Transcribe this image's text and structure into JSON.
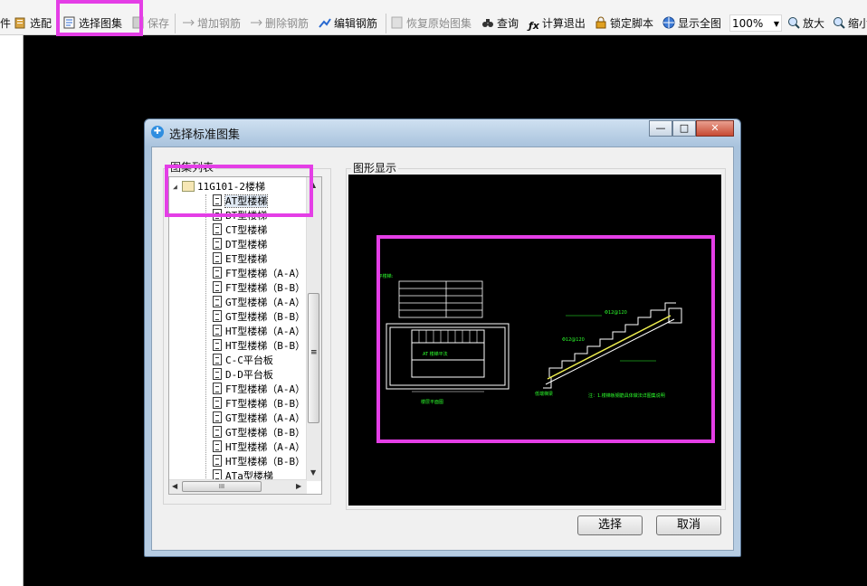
{
  "toolbar": {
    "items": [
      {
        "label": "件",
        "state": "enabled"
      },
      {
        "label": "选配",
        "state": "enabled"
      },
      {
        "label": "选择图集",
        "state": "enabled"
      },
      {
        "label": "保存",
        "state": "disabled"
      },
      {
        "label": "增加钢筋",
        "state": "disabled"
      },
      {
        "label": "删除钢筋",
        "state": "disabled"
      },
      {
        "label": "编辑钢筋",
        "state": "enabled"
      },
      {
        "label": "恢复原始图集",
        "state": "disabled"
      },
      {
        "label": "查询",
        "state": "enabled"
      },
      {
        "label": "计算退出",
        "state": "enabled"
      },
      {
        "label": "锁定脚本",
        "state": "enabled"
      },
      {
        "label": "显示全图",
        "state": "enabled"
      },
      {
        "label": "放大",
        "state": "enabled"
      },
      {
        "label": "缩小",
        "state": "enabled"
      }
    ],
    "zoom_value": "100%"
  },
  "dialog": {
    "title": "选择标准图集",
    "list_group_label": "图集列表",
    "preview_group_label": "图形显示",
    "tree_root": "11G101-2楼梯",
    "tree_items": [
      "AT型楼梯",
      "BT型楼梯",
      "CT型楼梯",
      "DT型楼梯",
      "ET型楼梯",
      "FT型楼梯（A-A）",
      "FT型楼梯（B-B）",
      "GT型楼梯（A-A）",
      "GT型楼梯（B-B）",
      "HT型楼梯（A-A）",
      "HT型楼梯（B-B）",
      "C-C平台板",
      "D-D平台板",
      "FT型楼梯（A-A）",
      "FT型楼梯（B-B）",
      "GT型楼梯（A-A）",
      "GT型楼梯（B-B）",
      "HT型楼梯（A-A）",
      "HT型楼梯（B-B）",
      "ATa型楼梯"
    ],
    "selected_item": "AT型楼梯",
    "select_button": "选择",
    "cancel_button": "取消",
    "window_buttons": {
      "minimize": "—",
      "maximize": "□",
      "close": "✕"
    },
    "scrollbar_glyphs": {
      "up": "▲",
      "down": "▼",
      "left": "◀",
      "right": "▶",
      "grip": "≡",
      "hgrip": "III"
    }
  },
  "colors": {
    "highlight": "#e43ee6",
    "cad_background": "#000000",
    "cad_lines": "#ffffff",
    "cad_text_green": "#2cff2c",
    "cad_accent_yellow": "#f0f050"
  },
  "icons": [
    "open-icon",
    "select-icon",
    "atlas-icon",
    "save-icon",
    "add-rebar-icon",
    "delete-rebar-icon",
    "edit-rebar-icon",
    "restore-icon",
    "binoculars-icon",
    "fx-icon",
    "lock-icon",
    "globe-icon",
    "zoom-in-icon",
    "zoom-out-icon",
    "dialog-app-icon",
    "book-icon",
    "document-icon"
  ]
}
